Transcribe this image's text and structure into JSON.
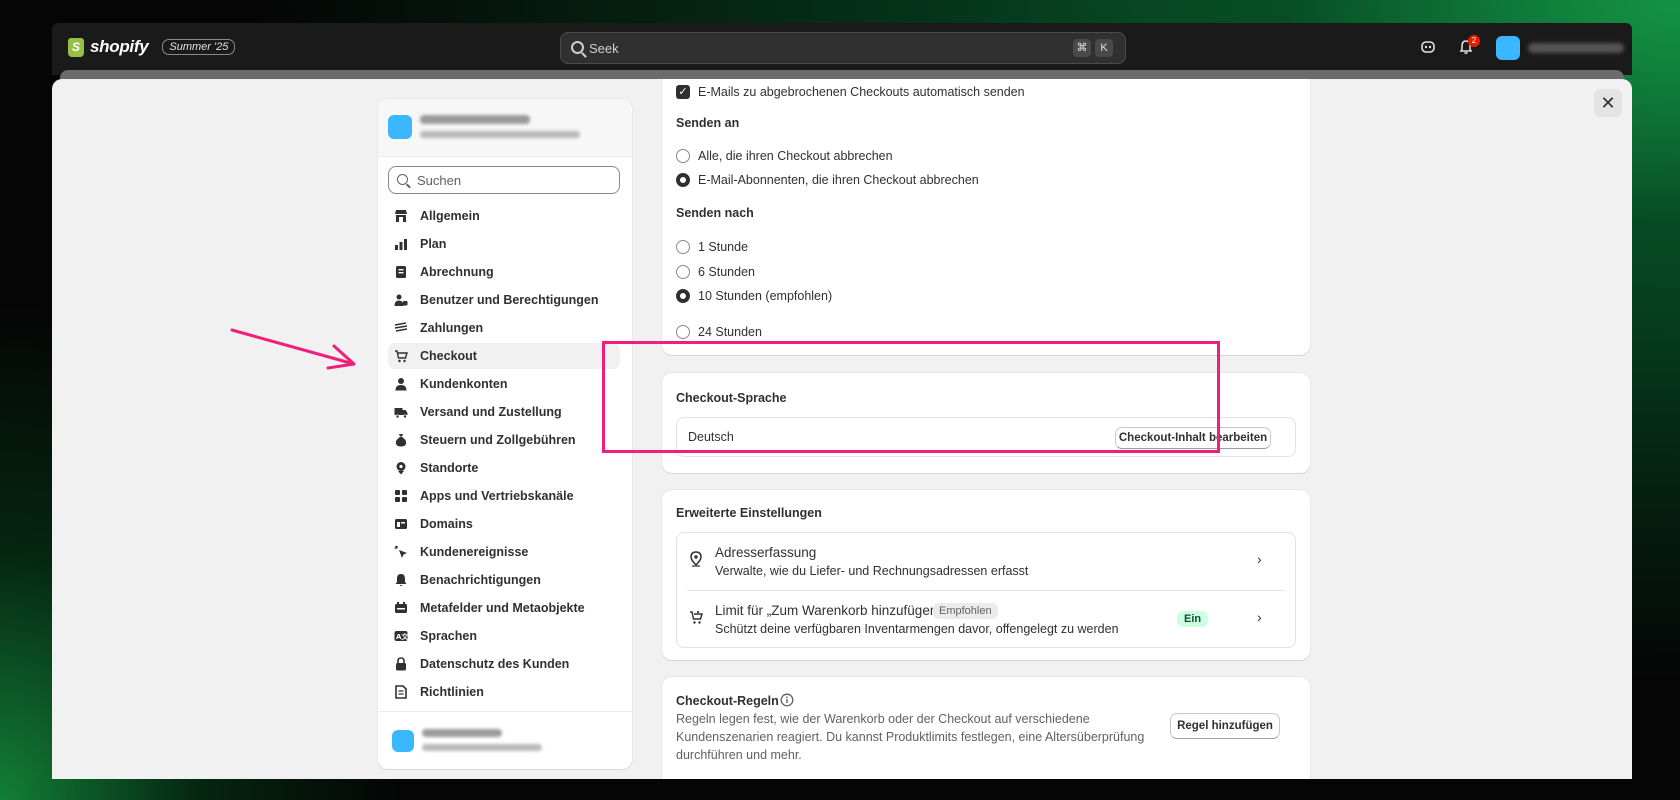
{
  "topbar": {
    "brand": "shopify",
    "edition": "Summer '25",
    "search_placeholder": "Seek",
    "shortcut_keys": [
      "⌘",
      "K"
    ],
    "notification_count": "2"
  },
  "sidebar": {
    "search_placeholder": "Suchen",
    "items": [
      {
        "label": "Allgemein",
        "icon": "store-icon"
      },
      {
        "label": "Plan",
        "icon": "plan-icon"
      },
      {
        "label": "Abrechnung",
        "icon": "receipt-icon"
      },
      {
        "label": "Benutzer und Berechtigungen",
        "icon": "users-icon"
      },
      {
        "label": "Zahlungen",
        "icon": "payments-icon"
      },
      {
        "label": "Checkout",
        "icon": "cart-icon",
        "active": true
      },
      {
        "label": "Kundenkonten",
        "icon": "person-icon"
      },
      {
        "label": "Versand und Zustellung",
        "icon": "truck-icon"
      },
      {
        "label": "Steuern und Zollgebühren",
        "icon": "tax-bag-icon"
      },
      {
        "label": "Standorte",
        "icon": "location-icon"
      },
      {
        "label": "Apps und Vertriebskanäle",
        "icon": "apps-icon"
      },
      {
        "label": "Domains",
        "icon": "globe-icon"
      },
      {
        "label": "Kundenereignisse",
        "icon": "cursor-icon"
      },
      {
        "label": "Benachrichtigungen",
        "icon": "bell-icon"
      },
      {
        "label": "Metafelder und Metaobjekte",
        "icon": "metafield-icon"
      },
      {
        "label": "Sprachen",
        "icon": "language-icon"
      },
      {
        "label": "Datenschutz des Kunden",
        "icon": "lock-icon"
      },
      {
        "label": "Richtlinien",
        "icon": "policy-icon"
      }
    ]
  },
  "abandoned": {
    "auto_send_label": "E-Mails zu abgebrochenen Checkouts automatisch senden",
    "send_to_title": "Senden an",
    "send_to_options": [
      "Alle, die ihren Checkout abbrechen",
      "E-Mail-Abonnenten, die ihren Checkout abbrechen"
    ],
    "send_after_title": "Senden nach",
    "send_after_options": [
      "1 Stunde",
      "6 Stunden",
      "10 Stunden (empfohlen)",
      "24 Stunden"
    ]
  },
  "language": {
    "title": "Checkout-Sprache",
    "value": "Deutsch",
    "edit_button": "Checkout-Inhalt bearbeiten"
  },
  "advanced": {
    "title": "Erweiterte Einstellungen",
    "address_title": "Adresserfassung",
    "address_desc": "Verwalte, wie du Liefer- und Rechnungsadressen erfasst",
    "limit_title": "Limit für „Zum Warenkorb hinzufügen“",
    "limit_badge": "Empfohlen",
    "limit_desc": "Schützt deine verfügbaren Inventarmengen davor, offengelegt zu werden",
    "limit_status": "Ein"
  },
  "rules": {
    "title": "Checkout-Regeln",
    "desc_line1": "Regeln legen fest, wie der Warenkorb oder der Checkout auf verschiedene",
    "desc_line2": "Kundenszenarien reagiert. Du kannst Produktlimits festlegen, eine Altersüberprüfung",
    "desc_line3": "durchführen und mehr.",
    "add_button": "Regel hinzufügen"
  },
  "colors": {
    "highlight": "#ef1f7b",
    "accent_avatar": "#3bb7ff",
    "status_on_bg": "#cdfee1"
  }
}
